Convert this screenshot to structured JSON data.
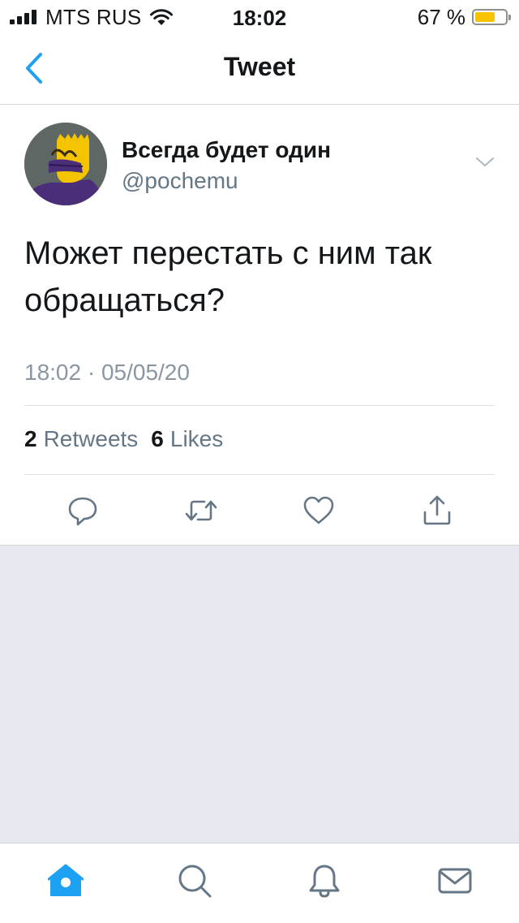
{
  "status_bar": {
    "carrier": "MTS RUS",
    "time": "18:02",
    "battery_percent": "67 %",
    "battery_level": 0.67,
    "battery_color": "#F7C300"
  },
  "nav": {
    "title": "Tweet",
    "back_icon": "chevron-left-icon"
  },
  "tweet": {
    "author": {
      "display_name": "Всегда будет один",
      "handle": "@pochemu"
    },
    "text": "Может перестать с ним так обращаться?",
    "timestamp": "18:02 · 05/05/20",
    "stats": {
      "retweets_count": "2",
      "retweets_label": "Retweets",
      "likes_count": "6",
      "likes_label": "Likes"
    },
    "actions": [
      "reply-icon",
      "retweet-icon",
      "like-icon",
      "share-icon"
    ]
  },
  "tab_bar": {
    "tabs": [
      "home-icon",
      "search-icon",
      "notifications-icon",
      "messages-icon"
    ],
    "active": "home-icon"
  },
  "colors": {
    "accent": "#1DA1F2",
    "secondary_text": "#657786",
    "background": "#E6E9F0"
  }
}
